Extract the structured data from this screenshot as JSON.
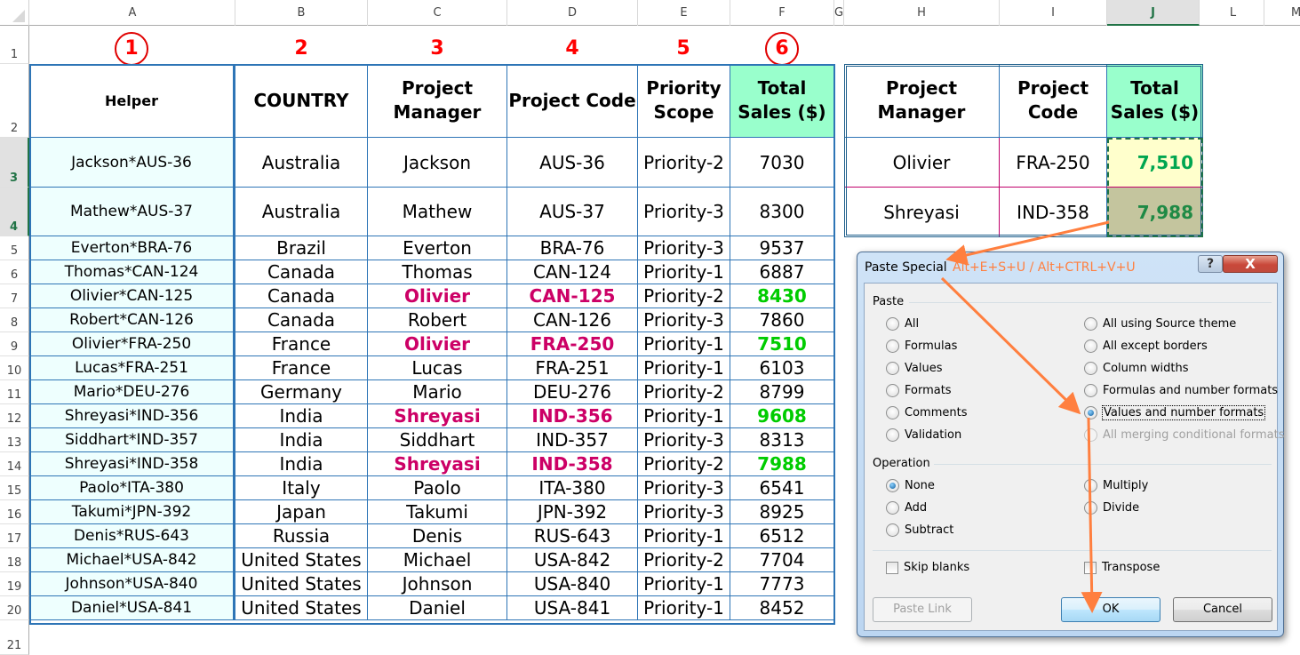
{
  "sheet": {
    "columns": [
      {
        "letter": "A"
      },
      {
        "letter": "B"
      },
      {
        "letter": "C"
      },
      {
        "letter": "D"
      },
      {
        "letter": "E"
      },
      {
        "letter": "F"
      },
      {
        "letter": "G"
      },
      {
        "letter": "H"
      },
      {
        "letter": "I"
      },
      {
        "letter": "J"
      },
      {
        "letter": "L"
      },
      {
        "letter": "M"
      }
    ],
    "selected_column": "J",
    "row_numbers": [
      "1",
      "2",
      "3",
      "4",
      "5",
      "6",
      "7",
      "8",
      "9",
      "10",
      "11",
      "12",
      "13",
      "14",
      "15",
      "16",
      "17",
      "18",
      "19",
      "20",
      "21"
    ],
    "selected_rows": [
      "3",
      "4"
    ],
    "step_labels": [
      "1",
      "2",
      "3",
      "4",
      "5",
      "6"
    ],
    "step_label_color": "#ff0000"
  },
  "main_table": {
    "headers": {
      "helper": "Helper",
      "country": "COUNTRY",
      "manager_line1": "Project",
      "manager_line2": "Manager",
      "code": "Project Code",
      "priority_line1": "Priority",
      "priority_line2": "Scope",
      "total_line1": "Total",
      "total_line2": "Sales ($)"
    },
    "rows": [
      {
        "helper": "Jackson*AUS-36",
        "country": "Australia",
        "manager": "Jackson",
        "code": "AUS-36",
        "priority": "Priority-2",
        "total": "7030",
        "highlight": false
      },
      {
        "helper": "Mathew*AUS-37",
        "country": "Australia",
        "manager": "Mathew",
        "code": "AUS-37",
        "priority": "Priority-3",
        "total": "8300",
        "highlight": false
      },
      {
        "helper": "Everton*BRA-76",
        "country": "Brazil",
        "manager": "Everton",
        "code": "BRA-76",
        "priority": "Priority-3",
        "total": "9537",
        "highlight": false
      },
      {
        "helper": "Thomas*CAN-124",
        "country": "Canada",
        "manager": "Thomas",
        "code": "CAN-124",
        "priority": "Priority-1",
        "total": "6887",
        "highlight": false
      },
      {
        "helper": "Olivier*CAN-125",
        "country": "Canada",
        "manager": "Olivier",
        "code": "CAN-125",
        "priority": "Priority-2",
        "total": "8430",
        "highlight": true
      },
      {
        "helper": "Robert*CAN-126",
        "country": "Canada",
        "manager": "Robert",
        "code": "CAN-126",
        "priority": "Priority-3",
        "total": "7860",
        "highlight": false
      },
      {
        "helper": "Olivier*FRA-250",
        "country": "France",
        "manager": "Olivier",
        "code": "FRA-250",
        "priority": "Priority-1",
        "total": "7510",
        "highlight": true
      },
      {
        "helper": "Lucas*FRA-251",
        "country": "France",
        "manager": "Lucas",
        "code": "FRA-251",
        "priority": "Priority-1",
        "total": "6103",
        "highlight": false
      },
      {
        "helper": "Mario*DEU-276",
        "country": "Germany",
        "manager": "Mario",
        "code": "DEU-276",
        "priority": "Priority-2",
        "total": "8799",
        "highlight": false
      },
      {
        "helper": "Shreyasi*IND-356",
        "country": "India",
        "manager": "Shreyasi",
        "code": "IND-356",
        "priority": "Priority-1",
        "total": "9608",
        "highlight": true
      },
      {
        "helper": "Siddhart*IND-357",
        "country": "India",
        "manager": "Siddhart",
        "code": "IND-357",
        "priority": "Priority-3",
        "total": "8313",
        "highlight": false
      },
      {
        "helper": "Shreyasi*IND-358",
        "country": "India",
        "manager": "Shreyasi",
        "code": "IND-358",
        "priority": "Priority-2",
        "total": "7988",
        "highlight": true
      },
      {
        "helper": "Paolo*ITA-380",
        "country": "Italy",
        "manager": "Paolo",
        "code": "ITA-380",
        "priority": "Priority-3",
        "total": "6541",
        "highlight": false
      },
      {
        "helper": "Takumi*JPN-392",
        "country": "Japan",
        "manager": "Takumi",
        "code": "JPN-392",
        "priority": "Priority-3",
        "total": "8925",
        "highlight": false
      },
      {
        "helper": "Denis*RUS-643",
        "country": "Russia",
        "manager": "Denis",
        "code": "RUS-643",
        "priority": "Priority-1",
        "total": "6512",
        "highlight": false
      },
      {
        "helper": "Michael*USA-842",
        "country": "United States",
        "manager": "Michael",
        "code": "USA-842",
        "priority": "Priority-2",
        "total": "7704",
        "highlight": false
      },
      {
        "helper": "Johnson*USA-840",
        "country": "United States",
        "manager": "Johnson",
        "code": "USA-840",
        "priority": "Priority-1",
        "total": "7773",
        "highlight": false
      },
      {
        "helper": "Daniel*USA-841",
        "country": "United States",
        "manager": "Daniel",
        "code": "USA-841",
        "priority": "Priority-1",
        "total": "8452",
        "highlight": false
      }
    ],
    "colors": {
      "helper_fill": "#eefffe",
      "total_header_fill": "#99ffcc",
      "highlight_text": "#cc0066",
      "highlight_total": "#00cc00",
      "border": "#2e75b6"
    }
  },
  "lookup_table": {
    "headers": {
      "manager_line1": "Project",
      "manager_line2": "Manager",
      "code_line1": "Project",
      "code_line2": "Code",
      "total_line1": "Total",
      "total_line2": "Sales ($)"
    },
    "rows": [
      {
        "manager": "Olivier",
        "code": "FRA-250",
        "total": "7,510"
      },
      {
        "manager": "Shreyasi",
        "code": "IND-358",
        "total": "7,988"
      }
    ],
    "colors": {
      "row1_total_fill": "#ffffcc",
      "row2_total_fill": "#c4c59e",
      "total_text": "#00a650",
      "row_divider": "#c0006a"
    }
  },
  "dialog": {
    "title": "Paste Special",
    "shortcut_annotation": "Alt+E+S+U / Alt+CTRL+V+U",
    "help_label": "?",
    "close_label": "X",
    "paste_group_label": "Paste",
    "paste_options_left": [
      {
        "label": "All",
        "checked": false,
        "disabled": false
      },
      {
        "label": "Formulas",
        "checked": false,
        "disabled": false
      },
      {
        "label": "Values",
        "checked": false,
        "disabled": false
      },
      {
        "label": "Formats",
        "checked": false,
        "disabled": false
      },
      {
        "label": "Comments",
        "checked": false,
        "disabled": false
      },
      {
        "label": "Validation",
        "checked": false,
        "disabled": false
      }
    ],
    "paste_options_right": [
      {
        "label": "All using Source theme",
        "checked": false,
        "disabled": false
      },
      {
        "label": "All except borders",
        "checked": false,
        "disabled": false
      },
      {
        "label": "Column widths",
        "checked": false,
        "disabled": false
      },
      {
        "label": "Formulas and number formats",
        "checked": false,
        "disabled": false
      },
      {
        "label": "Values and number formats",
        "checked": true,
        "disabled": false
      },
      {
        "label": "All merging conditional formats",
        "checked": false,
        "disabled": true
      }
    ],
    "operation_group_label": "Operation",
    "operation_options_left": [
      {
        "label": "None",
        "checked": true
      },
      {
        "label": "Add",
        "checked": false
      },
      {
        "label": "Subtract",
        "checked": false
      }
    ],
    "operation_options_right": [
      {
        "label": "Multiply",
        "checked": false
      },
      {
        "label": "Divide",
        "checked": false
      }
    ],
    "skip_blanks_label": "Skip blanks",
    "skip_blanks_checked": false,
    "transpose_label": "Transpose",
    "transpose_checked": false,
    "paste_link_label": "Paste Link",
    "ok_label": "OK",
    "cancel_label": "Cancel",
    "annotation_color": "#ff7f3f"
  }
}
